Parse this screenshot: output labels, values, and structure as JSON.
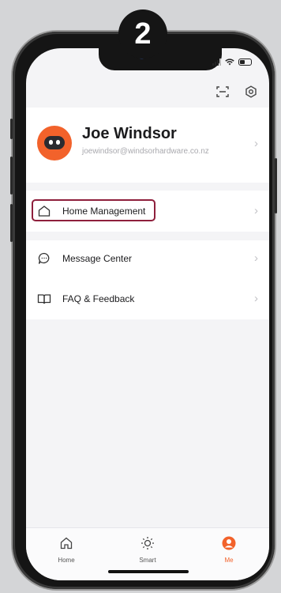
{
  "step_number": "2",
  "profile": {
    "name": "Joe Windsor",
    "email": "joewindsor@windsorhardware.co.nz"
  },
  "menu": {
    "home_management": "Home Management",
    "message_center": "Message Center",
    "faq_feedback": "FAQ & Feedback"
  },
  "tabs": [
    {
      "label": "Home",
      "icon": "home-icon"
    },
    {
      "label": "Smart",
      "icon": "sun-icon"
    },
    {
      "label": "Me",
      "icon": "user-icon",
      "active": true
    }
  ],
  "colors": {
    "accent": "#f2622b",
    "highlight_border": "#8e1f3c"
  }
}
